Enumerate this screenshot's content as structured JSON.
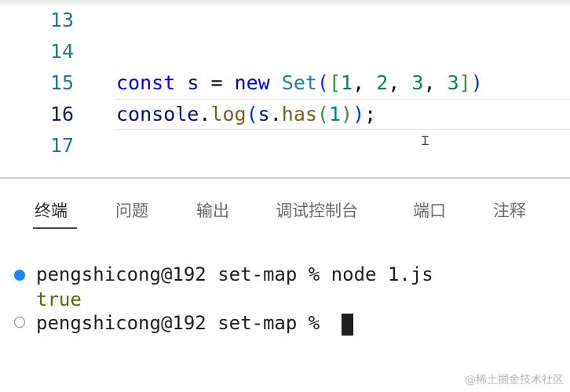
{
  "editor": {
    "lines": [
      {
        "number": "13",
        "tokens": []
      },
      {
        "number": "14",
        "tokens": []
      },
      {
        "number": "15",
        "tokens": [
          {
            "text": "const",
            "kind": "kw"
          },
          {
            "text": " ",
            "kind": "pun"
          },
          {
            "text": "s",
            "kind": "var"
          },
          {
            "text": " = ",
            "kind": "pun"
          },
          {
            "text": "new",
            "kind": "kw"
          },
          {
            "text": " ",
            "kind": "pun"
          },
          {
            "text": "Set",
            "kind": "cls"
          },
          {
            "text": "(",
            "kind": "br1"
          },
          {
            "text": "[",
            "kind": "br2"
          },
          {
            "text": "1",
            "kind": "num"
          },
          {
            "text": ", ",
            "kind": "pun"
          },
          {
            "text": "2",
            "kind": "num"
          },
          {
            "text": ", ",
            "kind": "pun"
          },
          {
            "text": "3",
            "kind": "num"
          },
          {
            "text": ", ",
            "kind": "pun"
          },
          {
            "text": "3",
            "kind": "num"
          },
          {
            "text": "]",
            "kind": "br2"
          },
          {
            "text": ")",
            "kind": "br1"
          }
        ]
      },
      {
        "number": "16",
        "tokens": [
          {
            "text": "console",
            "kind": "var"
          },
          {
            "text": ".",
            "kind": "pun"
          },
          {
            "text": "log",
            "kind": "fn"
          },
          {
            "text": "(",
            "kind": "br1"
          },
          {
            "text": "s",
            "kind": "var"
          },
          {
            "text": ".",
            "kind": "pun"
          },
          {
            "text": "has",
            "kind": "fn"
          },
          {
            "text": "(",
            "kind": "br2"
          },
          {
            "text": "1",
            "kind": "num"
          },
          {
            "text": ")",
            "kind": "br2"
          },
          {
            "text": ")",
            "kind": "br1"
          },
          {
            "text": ";",
            "kind": "pun"
          }
        ]
      },
      {
        "number": "17",
        "tokens": []
      }
    ],
    "active_line": "16"
  },
  "panel": {
    "tabs": [
      {
        "label": "终端",
        "name": "tab-terminal",
        "active": true
      },
      {
        "label": "问题",
        "name": "tab-problems",
        "active": false
      },
      {
        "label": "输出",
        "name": "tab-output",
        "active": false
      },
      {
        "label": "调试控制台",
        "name": "tab-debug-console",
        "active": false
      },
      {
        "label": "端口",
        "name": "tab-ports",
        "active": false
      },
      {
        "label": "注释",
        "name": "tab-comments",
        "active": false
      }
    ]
  },
  "terminal": {
    "line1": "pengshicong@192 set-map % node 1.js",
    "output": "true",
    "line3": "pengshicong@192 set-map % "
  },
  "watermark": "@稀土掘金技术社区",
  "colors": {
    "line_number": "#237893",
    "keyword": "#0000ff",
    "success_dot": "#1a85ff",
    "output_text": "#5c6b00"
  }
}
